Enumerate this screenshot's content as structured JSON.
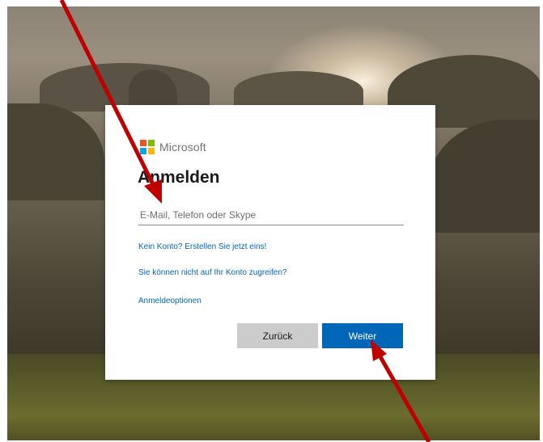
{
  "brand": {
    "name": "Microsoft",
    "logo_colors": [
      "#f25022",
      "#7fba00",
      "#00a4ef",
      "#ffb900"
    ]
  },
  "dialog": {
    "title": "Anmelden",
    "email_placeholder": "E-Mail, Telefon oder Skype",
    "email_value": "",
    "links": {
      "create_account": "Kein Konto? Erstellen Sie jetzt eins!",
      "no_access": "Sie können nicht auf Ihr Konto zugreifen?",
      "sign_in_options": "Anmeldeoptionen"
    },
    "buttons": {
      "back": "Zurück",
      "next": "Weiter"
    }
  },
  "annotations": {
    "arrow_color": "#c00000",
    "arrow_count": 2
  },
  "colors": {
    "accent": "#0067b8",
    "secondary_button": "#cccccc"
  }
}
